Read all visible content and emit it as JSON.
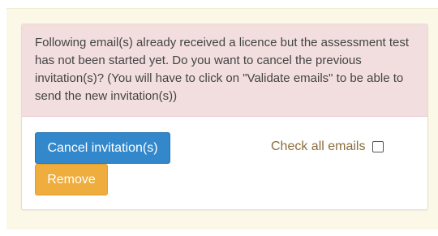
{
  "alert": {
    "message": "Following email(s) already received a licence but the assessment test has not been started yet. Do you want to cancel the previous invitation(s)? (You will have to click on \"Validate emails\" to be able to send the new invitation(s))"
  },
  "actions": {
    "cancel_label": "Cancel invitation(s)",
    "remove_label": "Remove",
    "check_all_label": "Check all emails",
    "check_all_checked": false
  },
  "colors": {
    "alert_bg": "#f2dede",
    "primary": "#3388cc",
    "warning": "#efad3e",
    "label_text": "#8a6d3b",
    "page_bg": "#fcf8e8"
  }
}
